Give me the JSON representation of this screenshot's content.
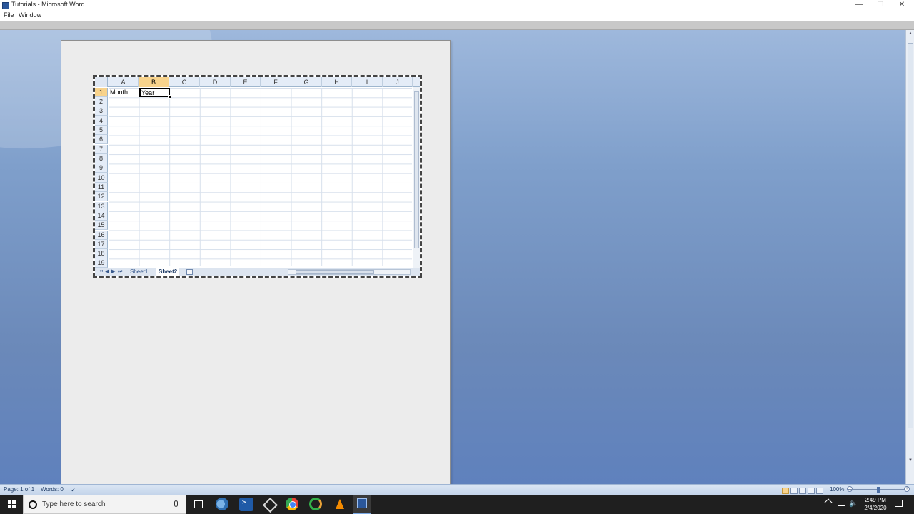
{
  "window": {
    "title": "Tutorials - Microsoft Word",
    "controls": {
      "minimize": "—",
      "maximize": "❐",
      "close": "✕"
    }
  },
  "menu": {
    "items": [
      "File",
      "Window"
    ]
  },
  "sheet": {
    "columns": [
      "A",
      "B",
      "C",
      "D",
      "E",
      "F",
      "G",
      "H",
      "I",
      "J"
    ],
    "active_column": "B",
    "rows": [
      "1",
      "2",
      "3",
      "4",
      "5",
      "6",
      "7",
      "8",
      "9",
      "10",
      "11",
      "12",
      "13",
      "14",
      "15",
      "16",
      "17",
      "18",
      "19"
    ],
    "active_row": "1",
    "cells": {
      "A1": "Month",
      "B1": "Year"
    },
    "tabs": [
      "Sheet1",
      "Sheet2"
    ],
    "active_tab": "Sheet2",
    "tab_nav": [
      "⏮",
      "◀",
      "▶",
      "⏭"
    ]
  },
  "status": {
    "page": "Page: 1 of 1",
    "words": "Words: 0",
    "zoom": "100%"
  },
  "taskbar": {
    "search_placeholder": "Type here to search",
    "time": "2:49 PM",
    "date": "2/4/2020"
  },
  "colors": {
    "workspace_blue": "#6b89b9",
    "selected_header": "#f8d38c",
    "word_blue": "#2b579a"
  }
}
